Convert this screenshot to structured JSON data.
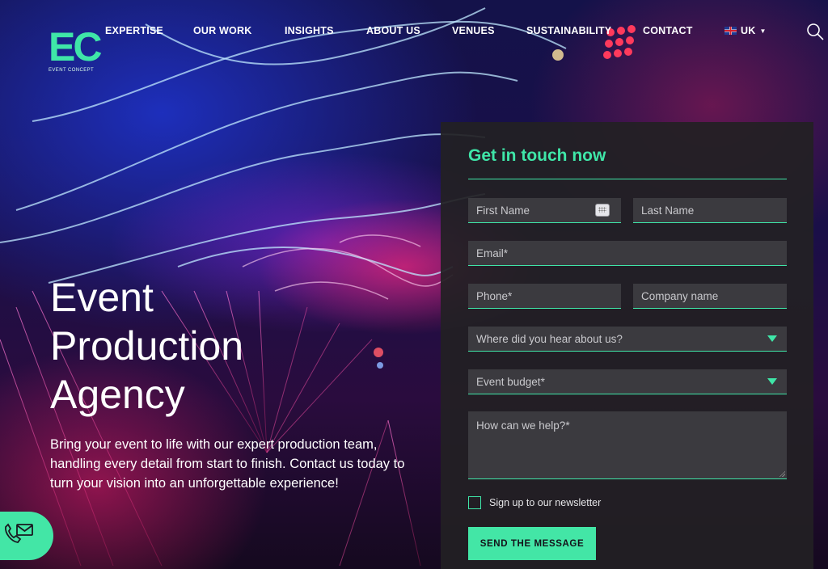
{
  "brand": {
    "logo_mark": "EC",
    "logo_sub": "EVENT CONCEPT",
    "accent": "#3fe6a8"
  },
  "nav": {
    "items": [
      "EXPERTISE",
      "OUR WORK",
      "INSIGHTS",
      "ABOUT US",
      "VENUES",
      "SUSTAINABILITY",
      "CONTACT"
    ],
    "language": "UK",
    "language_icon": "uk-flag-icon",
    "search_icon": "search-icon"
  },
  "hero": {
    "title_lines": [
      "Event",
      "Production",
      "Agency"
    ],
    "body": "Bring your event to life with our expert production team, handling every detail from start to finish. Contact us today to turn your vision into an unforgettable experience!",
    "float_icon": "phone-mail-icon"
  },
  "form": {
    "title": "Get in touch now",
    "first_name": {
      "placeholder": "First Name",
      "value": ""
    },
    "last_name": {
      "placeholder": "Last Name",
      "value": ""
    },
    "email": {
      "placeholder": "Email*",
      "value": ""
    },
    "phone": {
      "placeholder": "Phone*",
      "value": ""
    },
    "company": {
      "placeholder": "Company name",
      "value": ""
    },
    "source_select": "Where did you hear about us?",
    "budget_select": "Event budget*",
    "message_placeholder": "How can we help?*",
    "newsletter_label": "Sign up to our newsletter",
    "newsletter_checked": false,
    "submit_label": "SEND THE MESSAGE"
  }
}
